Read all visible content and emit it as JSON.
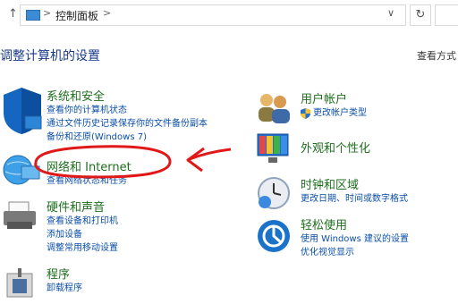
{
  "address_bar": {
    "up_glyph": "↑",
    "separator": ">",
    "breadcrumb": "控制面板",
    "dropdown_glyph": "∨",
    "refresh_glyph": "↻"
  },
  "page": {
    "title": "调整计算机的设置",
    "view_by": "查看方式"
  },
  "categories": [
    {
      "name": "系统和安全",
      "links": [
        "查看你的计算机状态",
        "通过文件历史记录保存你的文件备份副本",
        "备份和还原(Windows 7)"
      ]
    },
    {
      "name": "网络和 Internet",
      "links": [
        "查看网络状态和任务"
      ]
    },
    {
      "name": "硬件和声音",
      "links": [
        "查看设备和打印机",
        "添加设备",
        "调整常用移动设置"
      ]
    },
    {
      "name": "程序",
      "links": [
        "卸载程序"
      ]
    },
    {
      "name": "用户帐户",
      "links": [
        "更改帐户类型"
      ]
    },
    {
      "name": "外观和个性化",
      "links": []
    },
    {
      "name": "时钟和区域",
      "links": [
        "更改日期、时间或数字格式"
      ]
    },
    {
      "name": "轻松使用",
      "links": [
        "使用 Windows 建议的设置",
        "优化视觉显示"
      ]
    }
  ],
  "colors": {
    "category_name": "#1e6e1e",
    "link": "#0b4fa8",
    "annotation_red": "#e01818",
    "title": "#1a3a8c"
  }
}
